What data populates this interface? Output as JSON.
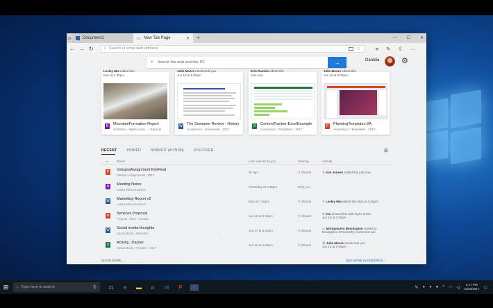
{
  "browser": {
    "tabs": [
      {
        "label": "Document1"
      },
      {
        "label": "New Tab Page"
      }
    ],
    "address_placeholder": "Search or enter web address"
  },
  "page": {
    "search_placeholder": "Search the web and this PC",
    "user_name": "Daniela",
    "cards": [
      {
        "meta_user": "Lesley Mia",
        "meta_action": "edited this",
        "meta_time": "Mon at 4:30pm",
        "name": "MountainFormation-Report",
        "path": "OneDrive › MyDocume... › Reports",
        "type": "onenote"
      },
      {
        "meta_user": "Julie Moore",
        "meta_action": "mentioned you",
        "meta_time": "Jun 18 at 6:00pm",
        "name": "The Sewanee Review - History",
        "path": "Academics › Homework › 2017",
        "type": "word"
      },
      {
        "meta_user": "Erin Daniels",
        "meta_action": "edited this",
        "meta_time": "Just now",
        "name": "ContentTracker-ExcelExample",
        "path": "Academics › Templates › 2017",
        "type": "excel"
      },
      {
        "meta_user": "Julie Moore",
        "meta_action": "edited this",
        "meta_time": "Jun 18 at 6:00pm",
        "name": "PlanningTemplates-2A",
        "path": "Academics › Templates › 2017",
        "type": "powerpoint"
      }
    ],
    "filter_tabs": [
      "RECENT",
      "PINNED",
      "SHARED WITH ME",
      "DISCOVER"
    ],
    "columns": {
      "name": "Name",
      "opened": "Last opened by you",
      "sharing": "Sharing",
      "activity": "Activity"
    },
    "rows": [
      {
        "name": "VolcanoAssignment KimFinal",
        "path": "Shared › Assignments › 2017",
        "date": "2h ago",
        "sharing": "Shared",
        "activity_user": "Kim Jensen",
        "activity": "edited this just now",
        "type": "powerpoint"
      },
      {
        "name": "Meeting Notes",
        "path": "Lesley Mia's OneDrive",
        "date": "Yesterday at 2:30pm",
        "sharing": "Only you",
        "activity_user": "",
        "activity": "",
        "type": "onenote"
      },
      {
        "name": "Marketing Report v2",
        "path": "Lesley Mia's OneDrive",
        "date": "Mon at 7:25pm",
        "sharing": "Shared",
        "activity_user": "Lesley Mia",
        "activity": "edited this Mon at 2:45pm",
        "type": "word"
      },
      {
        "name": "Services Proposal",
        "path": "Projects › 2017 › Groups",
        "date": "Jun 18 at 9:25pm",
        "sharing": "Shared",
        "activity_user": "You",
        "activity": "shared this with Ryan Smith",
        "activity2": "Jun 16 at 4:30pm",
        "type": "powerpoint"
      },
      {
        "name": "Social media thoughts",
        "path": "Social Media › Research",
        "date": "Jun 17 at 6:25pm",
        "sharing": "Shared",
        "activity_user": "Montgomery Bennington",
        "activity": "replied to",
        "activity2": "Evangeline O'Connelly's comment Jun",
        "type": "word"
      },
      {
        "name": "Activity_Tracker",
        "path": "Social Media › Trackers › 2017",
        "date": "Jun 16 at 4:30pm",
        "sharing": "Shared",
        "activity_user": "Julie Moore",
        "activity": "mentioned you",
        "activity2": "Jun 13 at 4:30pm",
        "type": "excel"
      }
    ],
    "show_more": "SHOW MORE",
    "see_more": "SEE MORE IN ONEDRIVE"
  },
  "taskbar": {
    "search_placeholder": "Type here to search",
    "time": "2:17 PM",
    "date": "11/28/2017"
  },
  "colors": {
    "accent": "#1f7ad6",
    "word": "#2b5797",
    "excel": "#217346",
    "powerpoint": "#d24726",
    "onenote": "#7719aa"
  },
  "icons": [
    "back-icon",
    "forward-icon",
    "refresh-icon",
    "search-icon",
    "arrow-right-icon",
    "gear-icon",
    "grid-icon",
    "windows-icon",
    "microphone-icon"
  ]
}
